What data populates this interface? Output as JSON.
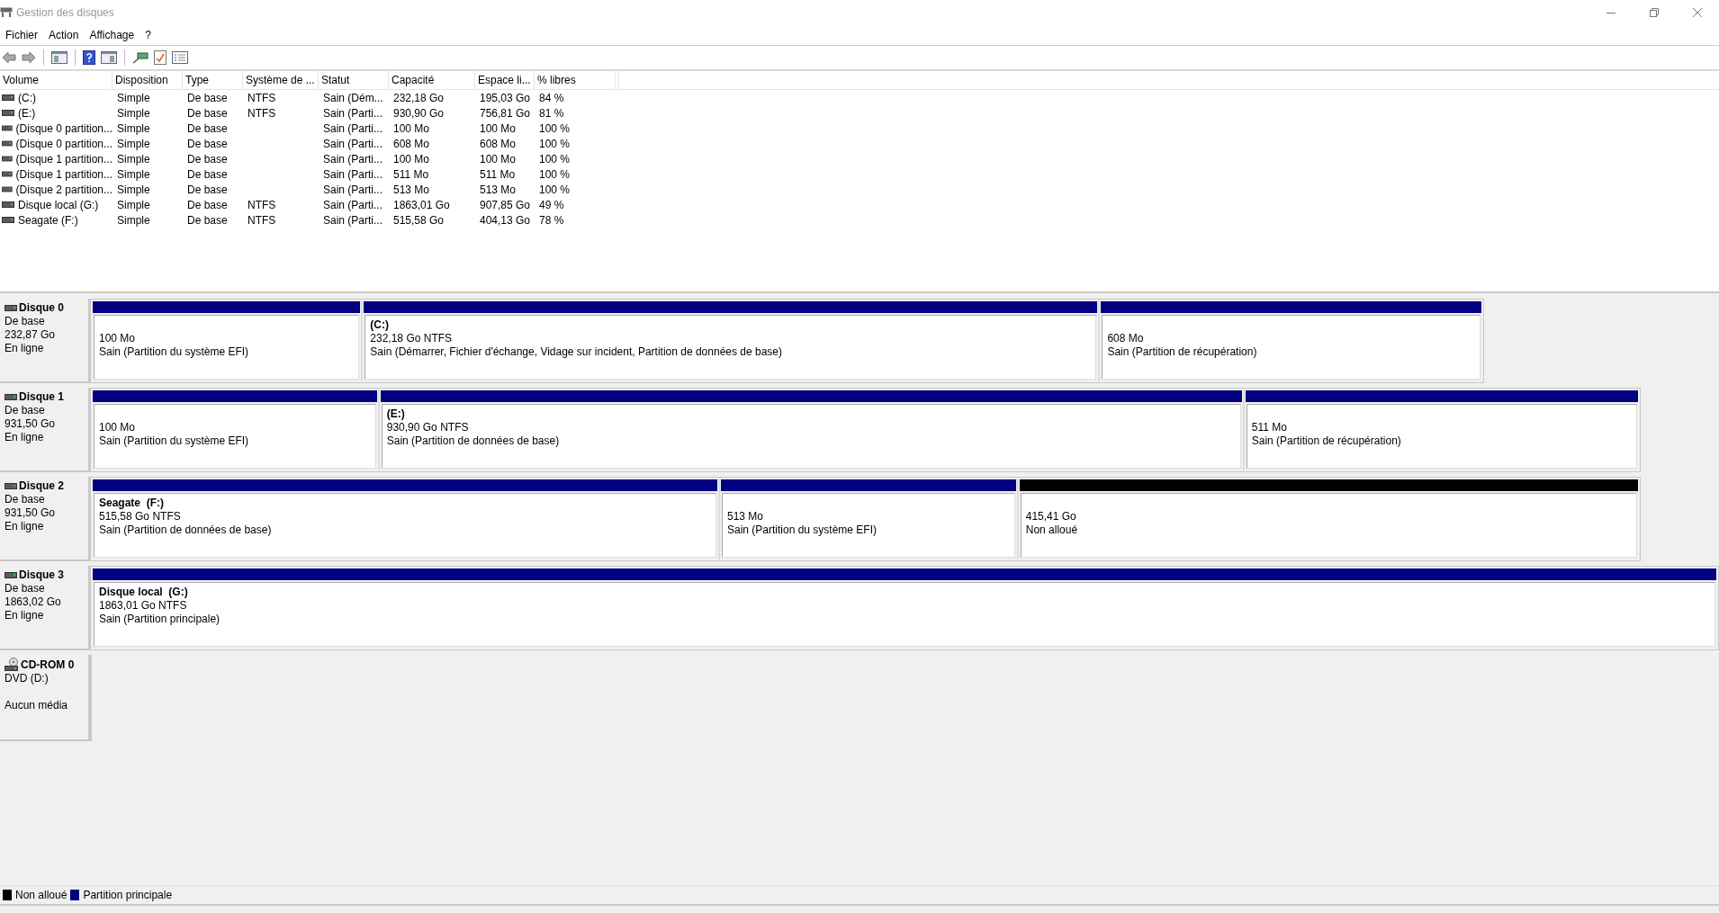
{
  "window": {
    "title": "Gestion des disques"
  },
  "menu": [
    "Fichier",
    "Action",
    "Affichage",
    "?"
  ],
  "table": {
    "columns": [
      "Volume",
      "Disposition",
      "Type",
      "Système de ...",
      "Statut",
      "Capacité",
      "Espace li...",
      "% libres"
    ],
    "rows": [
      {
        "cells": [
          "(C:)",
          "Simple",
          "De base",
          "NTFS",
          "Sain (Dém...",
          "232,18 Go",
          "195,03 Go",
          "84 %"
        ]
      },
      {
        "cells": [
          "(E:)",
          "Simple",
          "De base",
          "NTFS",
          "Sain (Parti...",
          "930,90 Go",
          "756,81 Go",
          "81 %"
        ]
      },
      {
        "cells": [
          "(Disque 0 partition...",
          "Simple",
          "De base",
          "",
          "Sain (Parti...",
          "100 Mo",
          "100 Mo",
          "100 %"
        ]
      },
      {
        "cells": [
          "(Disque 0 partition...",
          "Simple",
          "De base",
          "",
          "Sain (Parti...",
          "608 Mo",
          "608 Mo",
          "100 %"
        ]
      },
      {
        "cells": [
          "(Disque 1 partition...",
          "Simple",
          "De base",
          "",
          "Sain (Parti...",
          "100 Mo",
          "100 Mo",
          "100 %"
        ]
      },
      {
        "cells": [
          "(Disque 1 partition...",
          "Simple",
          "De base",
          "",
          "Sain (Parti...",
          "511 Mo",
          "511 Mo",
          "100 %"
        ]
      },
      {
        "cells": [
          "(Disque 2 partition...",
          "Simple",
          "De base",
          "",
          "Sain (Parti...",
          "513 Mo",
          "513 Mo",
          "100 %"
        ]
      },
      {
        "cells": [
          "Disque local (G:)",
          "Simple",
          "De base",
          "NTFS",
          "Sain (Parti...",
          "1863,01 Go",
          "907,85 Go",
          "49 %"
        ]
      },
      {
        "cells": [
          "Seagate (F:)",
          "Simple",
          "De base",
          "NTFS",
          "Sain (Parti...",
          "515,58 Go",
          "404,13 Go",
          "78 %"
        ]
      }
    ]
  },
  "disks": [
    {
      "kind": "disk",
      "name": "Disque 0",
      "type": "De base",
      "size": "232,87 Go",
      "status": "En ligne",
      "partitions": [
        {
          "kind": "primary",
          "size": "100 Mo",
          "status": "Sain (Partition du système EFI)"
        },
        {
          "kind": "primary",
          "name": "(C:)",
          "size": "232,18 Go NTFS",
          "status": "Sain (Démarrer, Fichier d'échange, Vidage sur incident, Partition de données de base)"
        },
        {
          "kind": "primary",
          "size": "608 Mo",
          "status": "Sain (Partition de récupération)"
        }
      ]
    },
    {
      "kind": "disk",
      "name": "Disque 1",
      "type": "De base",
      "size": "931,50 Go",
      "status": "En ligne",
      "partitions": [
        {
          "kind": "primary",
          "size": "100 Mo",
          "status": "Sain (Partition du système EFI)"
        },
        {
          "kind": "primary",
          "name": "(E:)",
          "size": "930,90 Go NTFS",
          "status": "Sain (Partition de données de base)"
        },
        {
          "kind": "primary",
          "size": "511 Mo",
          "status": "Sain (Partition de récupération)"
        }
      ]
    },
    {
      "kind": "disk",
      "name": "Disque 2",
      "type": "De base",
      "size": "931,50 Go",
      "status": "En ligne",
      "partitions": [
        {
          "kind": "primary",
          "name": "Seagate  (F:)",
          "size": "515,58 Go NTFS",
          "status": "Sain (Partition de données de base)"
        },
        {
          "kind": "primary",
          "size": "513 Mo",
          "status": "Sain (Partition du système EFI)"
        },
        {
          "kind": "unallocated",
          "size": "415,41 Go",
          "status": "Non alloué"
        }
      ]
    },
    {
      "kind": "disk",
      "name": "Disque 3",
      "type": "De base",
      "size": "1863,02 Go",
      "status": "En ligne",
      "partitions": [
        {
          "kind": "primary",
          "name": "Disque local  (G:)",
          "size": "1863,01 Go NTFS",
          "status": "Sain (Partition principale)"
        }
      ]
    },
    {
      "kind": "cdrom",
      "name": "CD-ROM 0",
      "type": "DVD (D:)",
      "status": "Aucun média"
    }
  ],
  "legend": [
    {
      "label": "Non alloué",
      "color": "#000000"
    },
    {
      "label": "Partition principale",
      "color": "#000080"
    }
  ]
}
